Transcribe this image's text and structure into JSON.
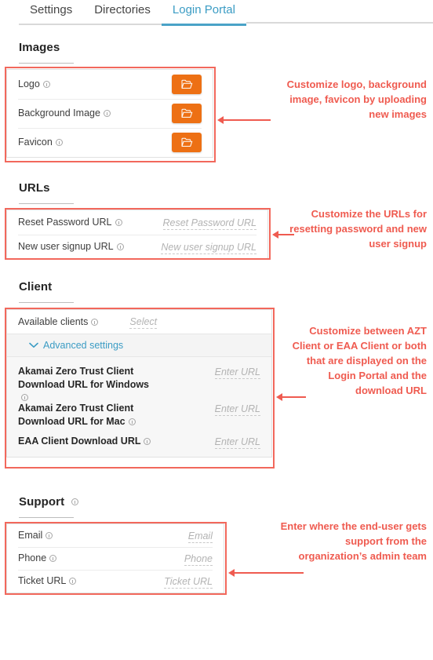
{
  "tabs": [
    {
      "label": "Settings",
      "active": false
    },
    {
      "label": "Directories",
      "active": false
    },
    {
      "label": "Login Portal",
      "active": true
    }
  ],
  "colors": {
    "accent_blue": "#3b9cc4",
    "button_orange": "#ed7014",
    "annotation_red": "#ef5b50"
  },
  "sections": {
    "images": {
      "title": "Images",
      "rows": [
        {
          "label": "Logo",
          "info": true,
          "action": "folder-upload"
        },
        {
          "label": "Background Image",
          "info": true,
          "action": "folder-upload"
        },
        {
          "label": "Favicon",
          "info": true,
          "action": "folder-upload"
        }
      ]
    },
    "urls": {
      "title": "URLs",
      "rows": [
        {
          "label": "Reset Password URL",
          "info": true,
          "placeholder": "Reset Password URL",
          "value": ""
        },
        {
          "label": "New user signup URL",
          "info": true,
          "placeholder": "New user signup URL",
          "value": ""
        }
      ]
    },
    "client": {
      "title": "Client",
      "available_clients": {
        "label": "Available clients",
        "info": true,
        "placeholder": "Select",
        "value": ""
      },
      "advanced": {
        "label": "Advanced settings",
        "expanded": true,
        "icon": "chevron-down-icon"
      },
      "rows": [
        {
          "label": "Akamai Zero Trust Client Download URL for Windows",
          "info": true,
          "placeholder": "Enter URL",
          "value": ""
        },
        {
          "label": "Akamai Zero Trust Client Download URL for Mac",
          "info": true,
          "placeholder": "Enter URL",
          "value": ""
        },
        {
          "label": "EAA Client Download URL",
          "info": true,
          "placeholder": "Enter URL",
          "value": ""
        }
      ]
    },
    "support": {
      "title": "Support",
      "info": true,
      "rows": [
        {
          "label": "Email",
          "info": true,
          "placeholder": "Email",
          "value": ""
        },
        {
          "label": "Phone",
          "info": true,
          "placeholder": "Phone",
          "value": ""
        },
        {
          "label": "Ticket URL",
          "info": true,
          "placeholder": "Ticket URL",
          "value": ""
        }
      ]
    }
  },
  "annotations": {
    "images": "Customize logo, background image, favicon by uploading new images",
    "urls": "Customize the URLs for resetting password and new user signup",
    "client": "Customize between AZT Client or EAA Client  or both that  are displayed on the Login Portal and the download URL",
    "support": "Enter where the end-user gets support from the organization’s admin team"
  }
}
